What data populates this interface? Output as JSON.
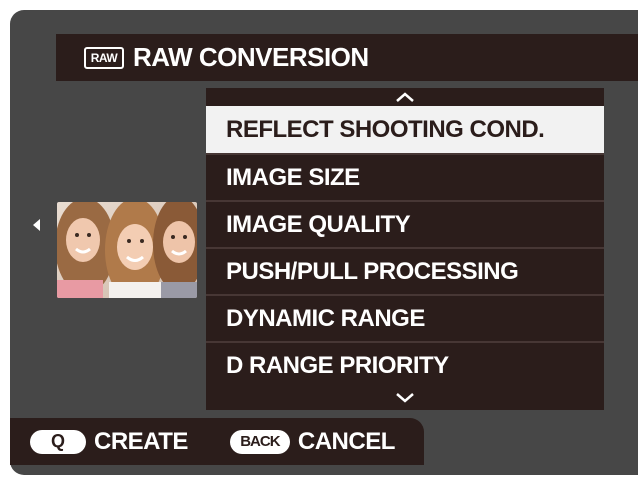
{
  "header": {
    "icon_label": "RAW",
    "title": "RAW CONVERSION"
  },
  "menu": {
    "scroll_up_icon": "chevron-up-icon",
    "scroll_down_icon": "chevron-down-icon",
    "items": [
      {
        "label": "REFLECT SHOOTING COND.",
        "selected": true
      },
      {
        "label": "IMAGE SIZE",
        "selected": false
      },
      {
        "label": "IMAGE QUALITY",
        "selected": false
      },
      {
        "label": "PUSH/PULL PROCESSING",
        "selected": false
      },
      {
        "label": "DYNAMIC RANGE",
        "selected": false
      },
      {
        "label": "D RANGE PRIORITY",
        "selected": false
      }
    ]
  },
  "preview": {
    "icon": "photo-thumbnail"
  },
  "footer": {
    "create_button": "Q",
    "create_label": "CREATE",
    "cancel_button": "BACK",
    "cancel_label": "CANCEL"
  },
  "colors": {
    "panel": "#2b1d1b",
    "background": "#474747",
    "selection": "#f2f2f2"
  }
}
